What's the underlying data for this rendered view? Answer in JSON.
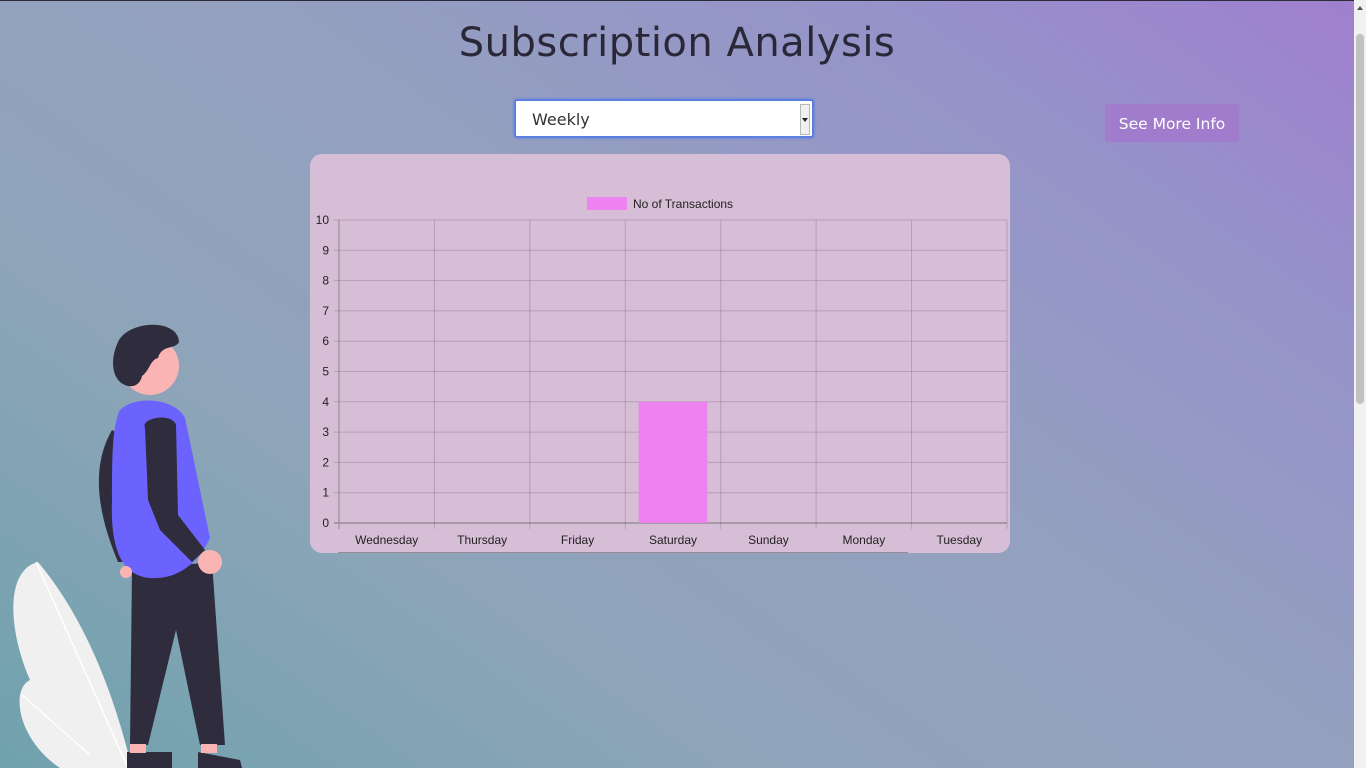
{
  "page": {
    "title": "Subscription Analysis"
  },
  "filter": {
    "selected": "Weekly"
  },
  "actions": {
    "more_info_label": "See More Info"
  },
  "chart_data": {
    "type": "bar",
    "categories": [
      "Wednesday",
      "Thursday",
      "Friday",
      "Saturday",
      "Sunday",
      "Monday",
      "Tuesday"
    ],
    "series": [
      {
        "name": "No of Transactions",
        "values": [
          0,
          0,
          0,
          4,
          0,
          0,
          0
        ],
        "color": "#ee82ee"
      }
    ],
    "ylim": [
      0,
      10
    ],
    "yticks": [
      0,
      1,
      2,
      3,
      4,
      5,
      6,
      7,
      8,
      9,
      10
    ],
    "legend": "top-center",
    "grid": true
  }
}
